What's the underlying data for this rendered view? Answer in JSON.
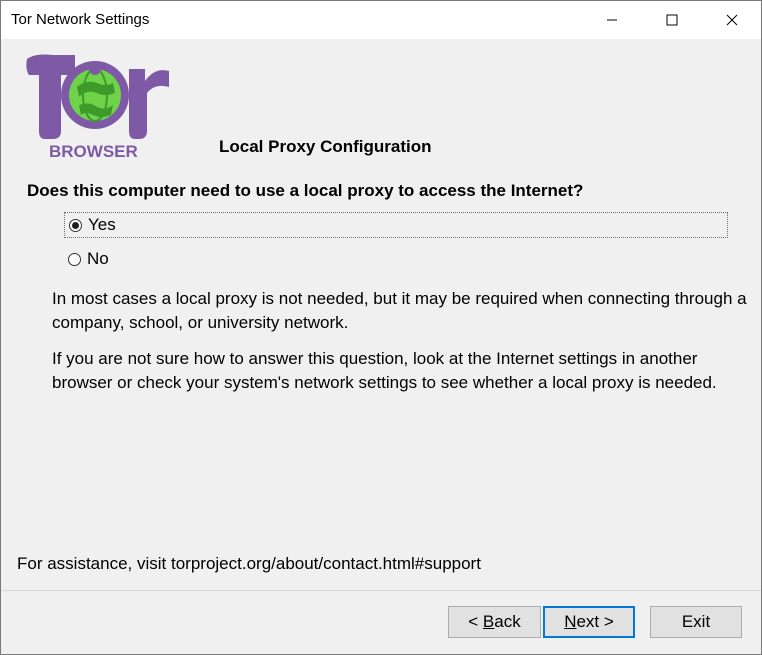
{
  "window": {
    "title": "Tor Network Settings"
  },
  "logo": {
    "text": "BROWSER"
  },
  "page": {
    "heading": "Local Proxy Configuration",
    "question": "Does this computer need to use a local proxy to access the Internet?",
    "options": [
      {
        "label": "Yes",
        "selected": true
      },
      {
        "label": "No",
        "selected": false
      }
    ],
    "para1": "In most cases a local proxy is not needed, but it may be required when connecting through a company, school, or university network.",
    "para2": "If you are not sure how to answer this question, look at the Internet settings in another browser or check your system's network settings to see whether a local proxy is needed.",
    "assistance": "For assistance, visit torproject.org/about/contact.html#support"
  },
  "buttons": {
    "back_prefix": "< ",
    "back_mnemonic": "B",
    "back_rest": "ack",
    "next_mnemonic": "N",
    "next_rest": "ext >",
    "exit": "Exit"
  },
  "colors": {
    "dialog_bg": "#f0f0f0",
    "focus_border": "#0078d7",
    "logo_purple": "#7e5aa6",
    "logo_green": "#6fd34a"
  }
}
